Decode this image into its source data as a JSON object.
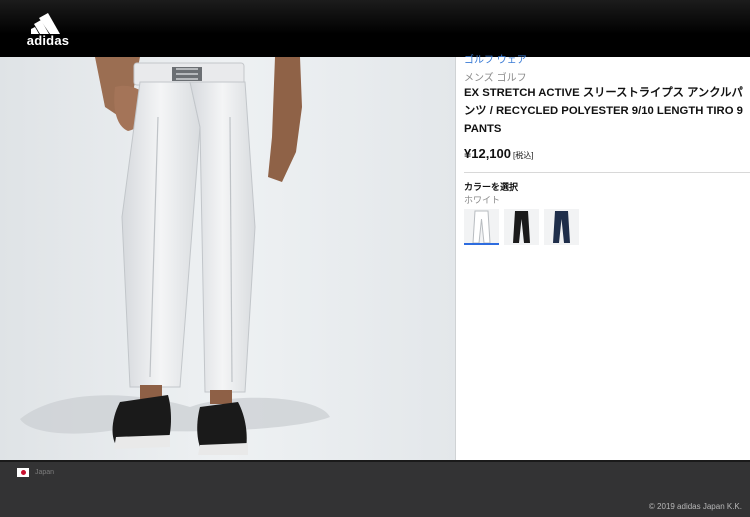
{
  "header": {
    "brand": "adidas"
  },
  "product": {
    "breadcrumb_partial": "ゴルフ ウェア",
    "category": "メンズ ゴルフ",
    "title": "EX STRETCH ACTIVE スリーストライプス アンクルパンツ / RECYCLED POLYESTER 9/10 LENGTH TIRO 9 PANTS",
    "price": "¥12,100",
    "tax_note": "[税込]",
    "color_label": "カラーを選択",
    "selected_color": "ホワイト",
    "swatches": [
      {
        "color": "white",
        "hex": "#eef0f2",
        "selected": true
      },
      {
        "color": "black",
        "hex": "#1b1b1b",
        "selected": false
      },
      {
        "color": "navy",
        "hex": "#1f2e4a",
        "selected": false
      }
    ]
  },
  "footer": {
    "locale": "Japan",
    "copyright": "© 2019 adidas Japan K.K."
  },
  "colors": {
    "header_bg": "#000000",
    "accent": "#2d6cdf",
    "footer_bg": "#333334"
  }
}
